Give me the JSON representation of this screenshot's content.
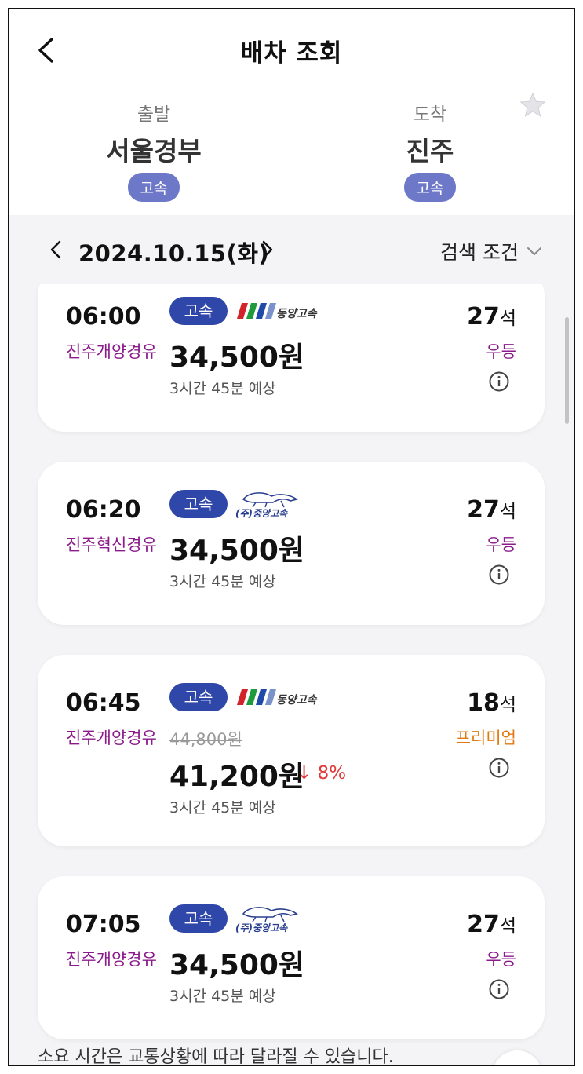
{
  "header": {
    "title": "배차 조회"
  },
  "route": {
    "departure": {
      "label": "출발",
      "name": "서울경부",
      "badge": "고속"
    },
    "arrival": {
      "label": "도착",
      "name": "진주",
      "badge": "고속"
    }
  },
  "date": {
    "text": "2024.10.15(화)",
    "filter_label": "검색 조건"
  },
  "colors": {
    "accent": "#2f47a8",
    "station_badge": "#6e78c9",
    "via": "#8b1a8b",
    "premium": "#e07a10",
    "discount": "#e03a3a"
  },
  "icons": [
    "back-arrow-icon",
    "star-icon",
    "chevron-left-icon",
    "chevron-right-icon",
    "chevron-down-icon",
    "info-icon",
    "dongyang-logo-icon",
    "jungang-logo-icon"
  ],
  "schedules": [
    {
      "time": "06:00",
      "via": "진주개양경유",
      "badge": "고속",
      "company": "동양고속",
      "price": "34,500원",
      "duration": "3시간 45분 예상",
      "seats_num": "27",
      "seats_unit": "석",
      "grade": "우등"
    },
    {
      "time": "06:20",
      "via": "진주혁신경유",
      "badge": "고속",
      "company": "(주)중앙고속",
      "price": "34,500원",
      "duration": "3시간 45분 예상",
      "seats_num": "27",
      "seats_unit": "석",
      "grade": "우등"
    },
    {
      "time": "06:45",
      "via": "진주개양경유",
      "badge": "고속",
      "company": "동양고속",
      "original_price": "44,800원",
      "price": "41,200원",
      "discount": "↓ 8%",
      "duration": "3시간 45분 예상",
      "seats_num": "18",
      "seats_unit": "석",
      "grade": "프리미엄"
    },
    {
      "time": "07:05",
      "via": "진주개양경유",
      "badge": "고속",
      "company": "(주)중앙고속",
      "price": "34,500원",
      "duration": "3시간 45분 예상",
      "seats_num": "27",
      "seats_unit": "석",
      "grade": "우등"
    }
  ],
  "footer": {
    "note": "소요 시간은 교통상황에 따라 달라질 수 있습니다."
  }
}
